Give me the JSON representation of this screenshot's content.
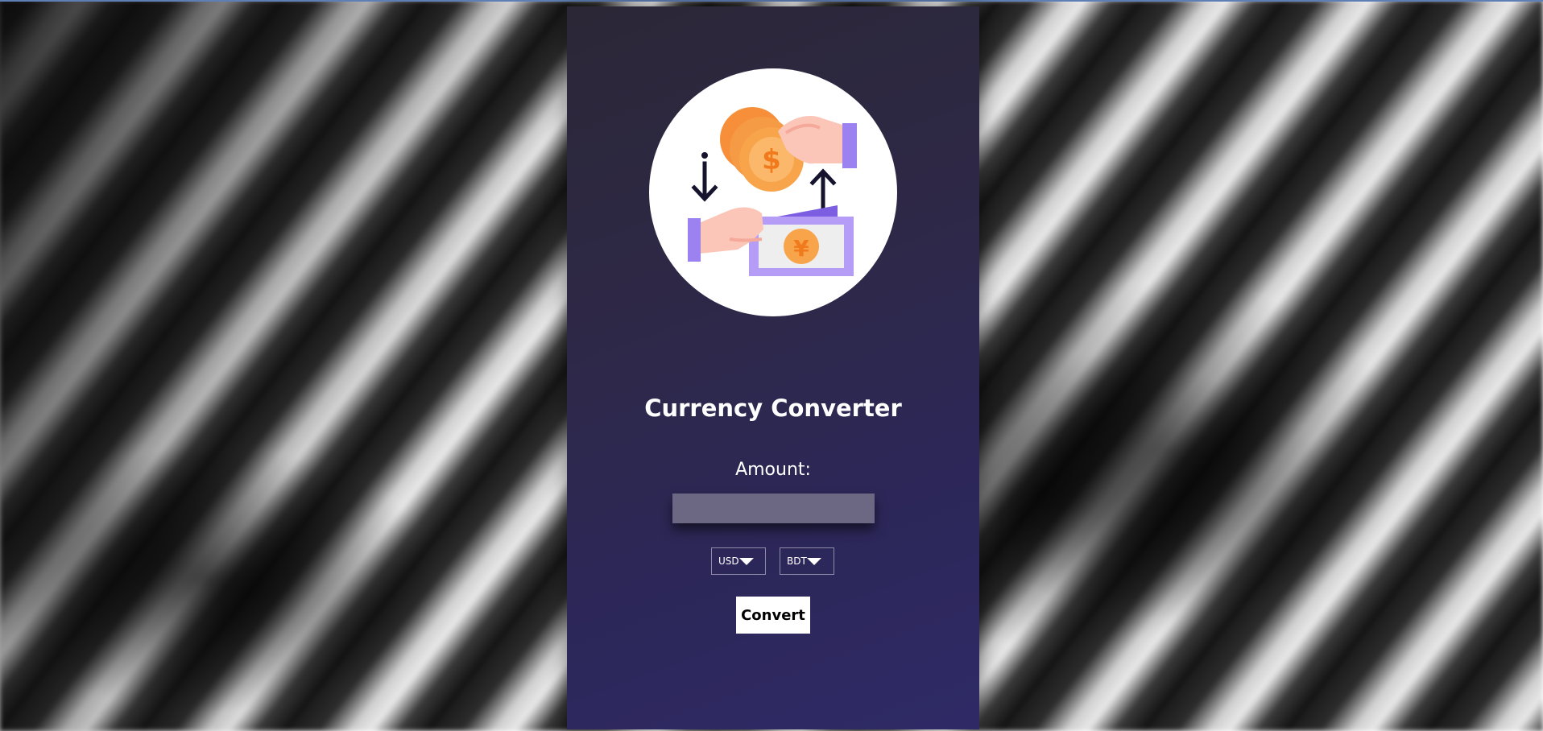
{
  "app": {
    "title": "Currency Converter"
  },
  "logo": {
    "icon": "currency-exchange-icon"
  },
  "form": {
    "amount_label": "Amount:",
    "amount_value": "",
    "amount_placeholder": "",
    "from_currency": "USD",
    "to_currency": "BDT",
    "convert_label": "Convert"
  },
  "colors": {
    "card_top": "#2b2736",
    "card_bottom": "#2f2a66",
    "input_bg": "#6c6883",
    "coin": "#f7a44a",
    "accent_purple": "#9b82f0"
  }
}
